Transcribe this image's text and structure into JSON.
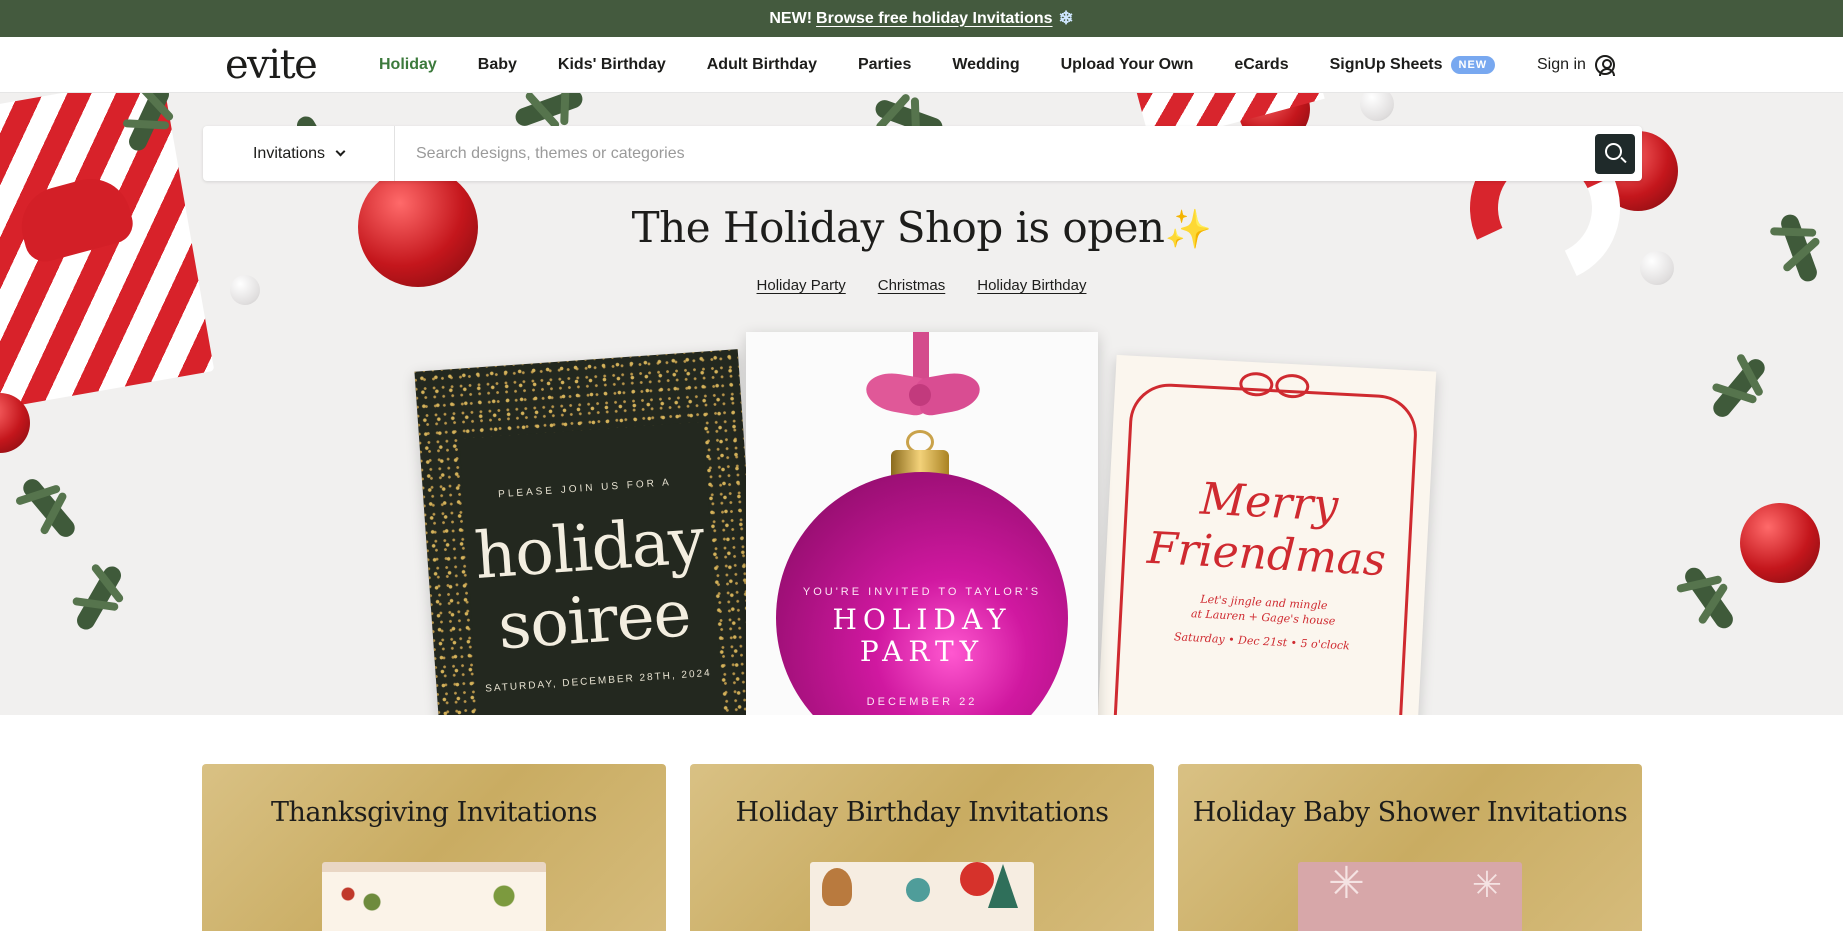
{
  "promo": {
    "prefix": "NEW!",
    "link": "Browse free holiday Invitations",
    "icon": "snowflake-icon"
  },
  "nav": {
    "logo": "evite",
    "items": [
      {
        "label": "Holiday",
        "active": true
      },
      {
        "label": "Baby"
      },
      {
        "label": "Kids' Birthday"
      },
      {
        "label": "Adult Birthday"
      },
      {
        "label": "Parties"
      },
      {
        "label": "Wedding"
      },
      {
        "label": "Upload Your Own"
      },
      {
        "label": "eCards"
      },
      {
        "label": "SignUp Sheets",
        "badge": "NEW"
      }
    ],
    "signin": "Sign in",
    "accent_color": "#3c7a3c",
    "badge_color": "#78a8f0"
  },
  "search": {
    "type_label": "Invitations",
    "placeholder": "Search designs, themes or categories"
  },
  "hero": {
    "title": "The Holiday Shop is open",
    "title_icon": "sparkles-icon",
    "links": [
      "Holiday Party",
      "Christmas",
      "Holiday Birthday"
    ],
    "cards": {
      "left": {
        "small": "PLEASE JOIN US FOR A",
        "big": "holiday soiree",
        "date": "SATURDAY, DECEMBER 28TH, 2024"
      },
      "middle": {
        "line1": "YOU'RE INVITED TO TAYLOR'S",
        "line2": "HOLIDAY PARTY",
        "line3": "DECEMBER 22"
      },
      "right": {
        "script": "Merry Friendmas",
        "line1": "Let's jingle and mingle\nat Lauren + Gage's house",
        "line2": "Saturday • Dec 21st • 5 o'clock"
      }
    }
  },
  "tiles": [
    {
      "title": "Thanksgiving Invitations"
    },
    {
      "title": "Holiday Birthday Invitations"
    },
    {
      "title": "Holiday Baby Shower Invitations"
    }
  ],
  "colors": {
    "banner": "#445a3e",
    "tile_gold": "#d2b874"
  }
}
